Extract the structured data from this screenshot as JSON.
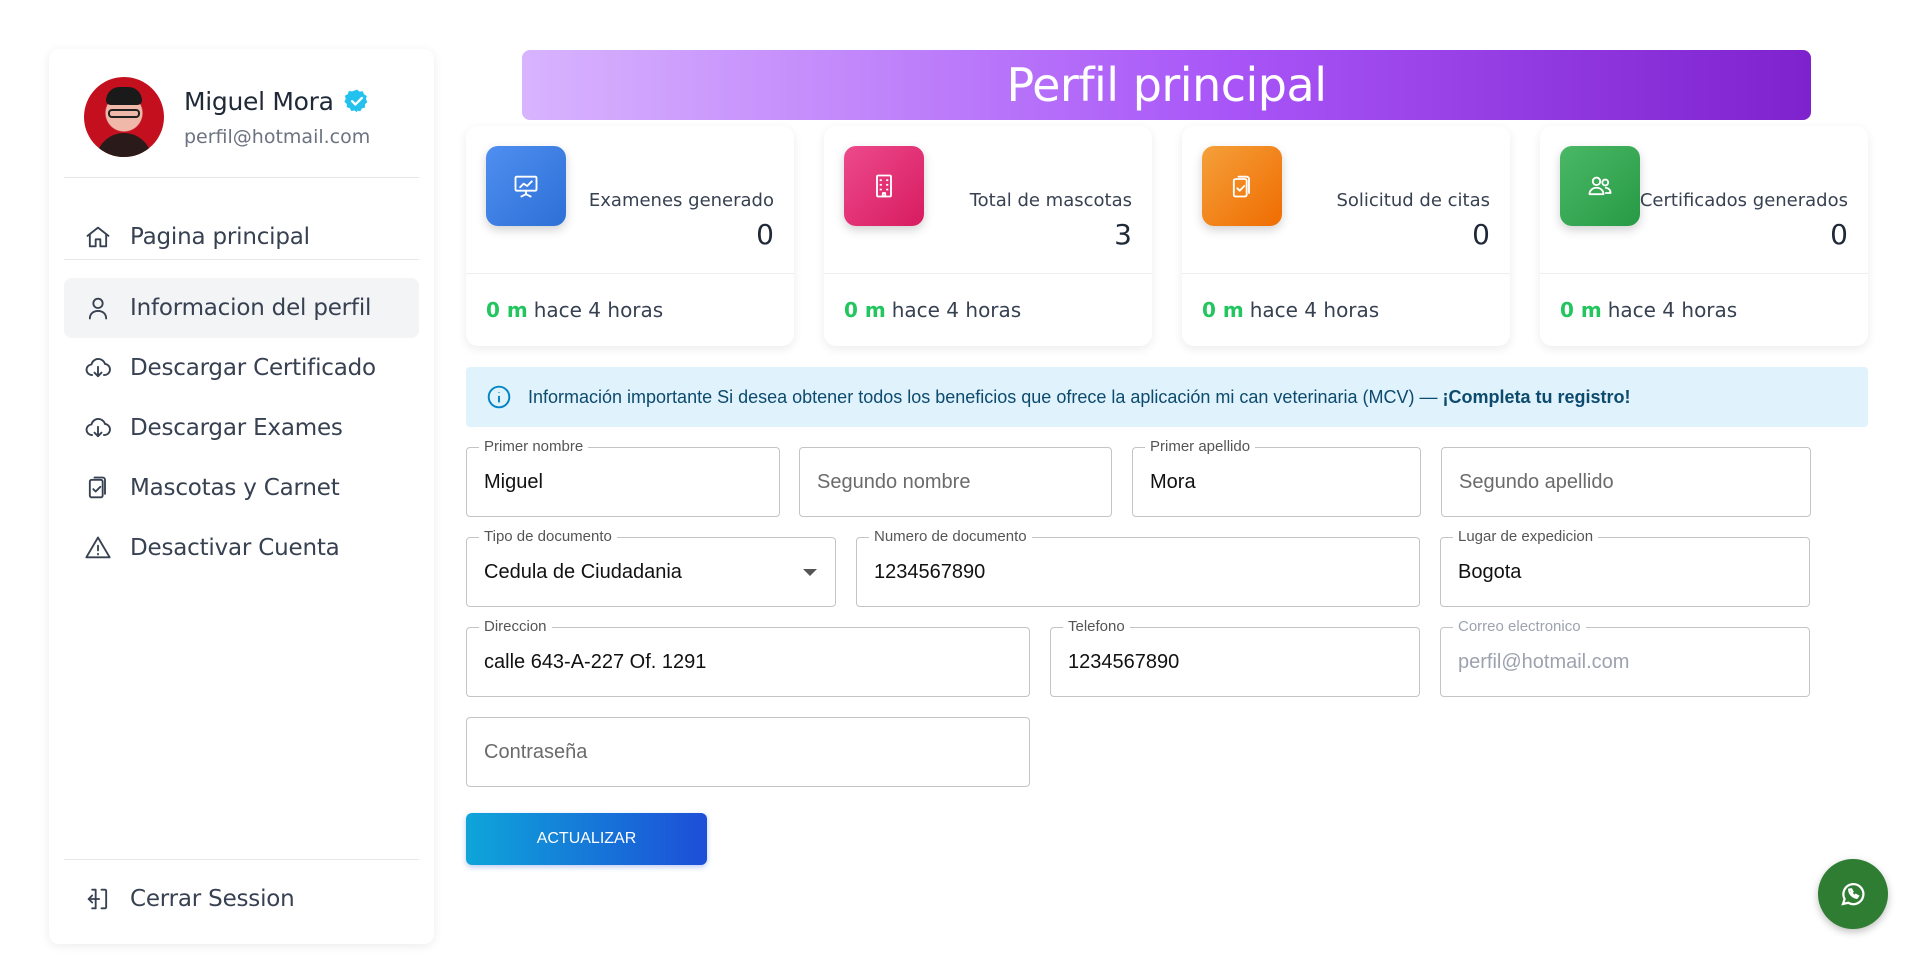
{
  "user": {
    "name": "Miguel Mora",
    "email": "perfil@hotmail.com"
  },
  "sidebar": {
    "items": [
      {
        "label": "Pagina principal",
        "icon": "home-icon"
      },
      {
        "label": "Informacion del perfil",
        "icon": "user-icon",
        "active": true
      },
      {
        "label": "Descargar Certificado",
        "icon": "cloud-download-icon"
      },
      {
        "label": "Descargar Exames",
        "icon": "cloud-download-icon"
      },
      {
        "label": "Mascotas y Carnet",
        "icon": "clipboard-check-icon"
      },
      {
        "label": "Desactivar Cuenta",
        "icon": "warning-icon"
      }
    ],
    "logout": {
      "label": "Cerrar Session",
      "icon": "logout-icon"
    }
  },
  "header": {
    "title": "Perfil principal"
  },
  "stats": [
    {
      "label": "Examenes generado",
      "value": "0",
      "delta": "0 m",
      "time": "hace 4 horas",
      "icon": "presentation-chart-icon",
      "color": "#3b82f6"
    },
    {
      "label": "Total de mascotas",
      "value": "3",
      "delta": "0 m",
      "time": "hace 4 horas",
      "icon": "building-icon",
      "color": "#e91e63"
    },
    {
      "label": "Solicitud de citas",
      "value": "0",
      "delta": "0 m",
      "time": "hace 4 horas",
      "icon": "clipboard-check-icon",
      "color": "#f57c00"
    },
    {
      "label": "Certificados generados",
      "value": "0",
      "delta": "0 m",
      "time": "hace 4 horas",
      "icon": "users-icon",
      "color": "#2ea44f"
    }
  ],
  "alert": {
    "text": "Información importante Si desea obtener todos los beneficios que ofrece la aplicación mi can veterinaria (MCV) —",
    "emphasis": "¡Completa tu registro!"
  },
  "form": {
    "primer_nombre": {
      "label": "Primer nombre",
      "value": "Miguel"
    },
    "segundo_nombre": {
      "placeholder": "Segundo nombre"
    },
    "primer_apellido": {
      "label": "Primer apellido",
      "value": "Mora"
    },
    "segundo_apellido": {
      "placeholder": "Segundo apellido"
    },
    "tipo_documento": {
      "label": "Tipo de documento",
      "value": "Cedula de Ciudadania"
    },
    "numero_documento": {
      "label": "Numero de documento",
      "value": "1234567890"
    },
    "lugar_expedicion": {
      "label": "Lugar de expedicion",
      "value": "Bogota"
    },
    "direccion": {
      "label": "Direccion",
      "value": "calle 643-A-227 Of. 1291"
    },
    "telefono": {
      "label": "Telefono",
      "value": "1234567890"
    },
    "correo": {
      "label": "Correo electronico",
      "value": "perfil@hotmail.com"
    },
    "contrasena": {
      "placeholder": "Contraseña"
    },
    "submit_label": "ACTUALIZAR"
  },
  "colors": {
    "banner_start": "#d8b4fe",
    "banner_end": "#7e22ce",
    "accent_green": "#22c55e",
    "whatsapp": "#2e7d32"
  }
}
